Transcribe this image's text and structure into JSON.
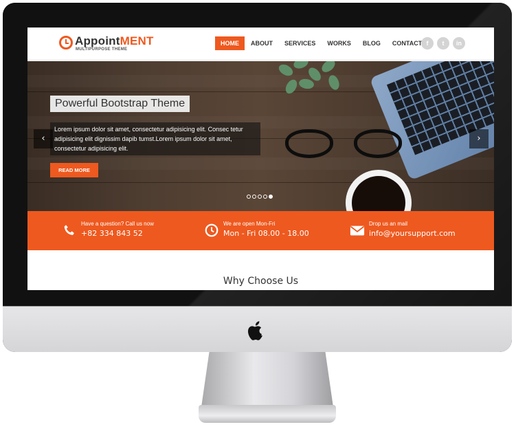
{
  "logo": {
    "name_main": "Appoint",
    "name_accent": "MENT",
    "tagline": "MULTIPURPOSE THEME"
  },
  "nav": {
    "items": [
      "HOME",
      "ABOUT",
      "SERVICES",
      "WORKS",
      "BLOG",
      "CONTACT"
    ],
    "active": "HOME"
  },
  "social": [
    "f",
    "t",
    "in"
  ],
  "hero": {
    "title": "Powerful Bootstrap Theme",
    "description": "Lorem ipsum dolor sit amet, consectetur adipisicing elit. Consec tetur adipisicing elit dignissim dapib tumst.Lorem ipsum dolor sit amet, consectetur adipisicing elit.",
    "button": "READ MORE",
    "prev_icon": "chevron-left-icon",
    "next_icon": "chevron-right-icon",
    "slide_count": 5,
    "active_slide": 5
  },
  "info": [
    {
      "label": "Have a question? Call us now",
      "value": "+82 334 843 52",
      "icon": "phone-icon"
    },
    {
      "label": "We are open Mon-Fri",
      "value": "Mon - Fri 08.00 - 18.00",
      "icon": "clock-icon"
    },
    {
      "label": "Drop us an mail",
      "value": "info@yoursupport.com",
      "icon": "mail-icon"
    }
  ],
  "section": {
    "title": "Why Choose Us"
  },
  "colors": {
    "accent": "#ee591f",
    "nav_text": "#333333",
    "social": "#d4d4d4"
  }
}
